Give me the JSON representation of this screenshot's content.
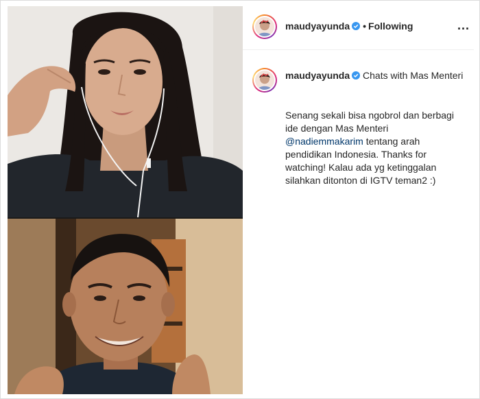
{
  "post": {
    "username": "maudyayunda",
    "follow_status": "Following",
    "separator": "•",
    "more_label": "..."
  },
  "caption": {
    "username": "maudyayunda",
    "title": "Chats with Mas Menteri",
    "body_before_mention": "Senang sekali bisa ngobrol dan berbagi ide dengan Mas Menteri",
    "mention": "@nadiemmakarim",
    "body_after_mention": "tentang arah pendidikan Indonesia. Thanks for watching! Kalau ada yg ketinggalan silahkan ditonton di IGTV teman2 :)"
  },
  "colors": {
    "verified_badge": "#3897f0",
    "mention_link": "#00376b",
    "text": "#262626",
    "divider": "#efefef"
  },
  "icons": {
    "verified": "verified-badge-icon",
    "more": "more-options-icon"
  }
}
